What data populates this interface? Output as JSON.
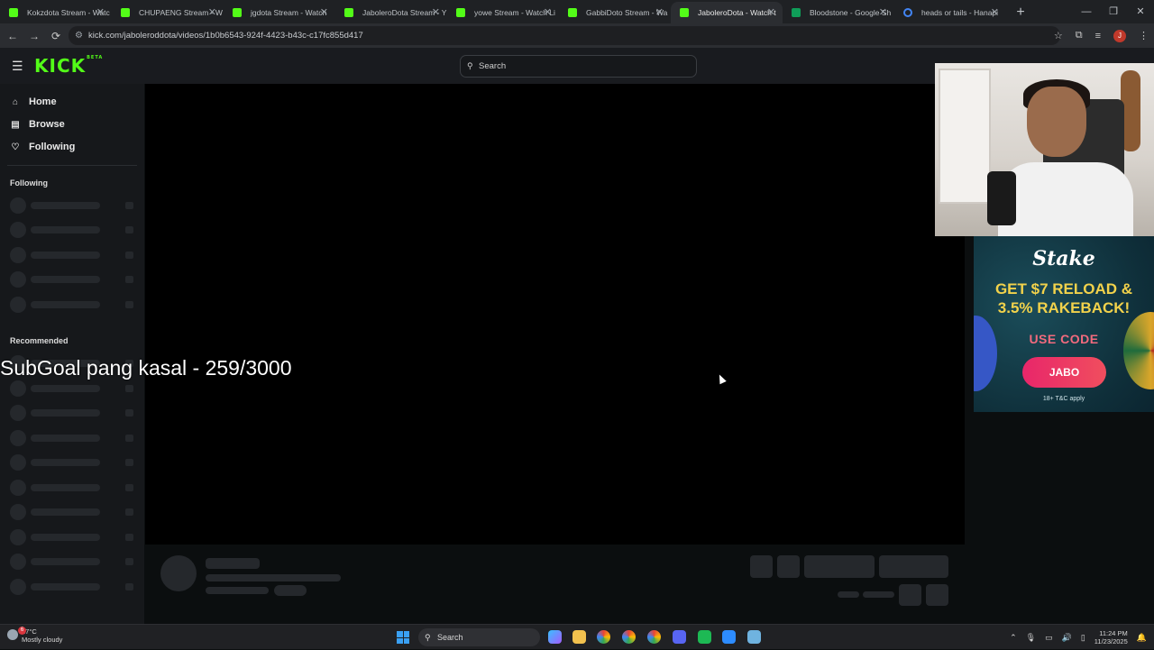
{
  "browser": {
    "tabs": [
      {
        "title": "Kokzdota Stream - Watc",
        "favicon": "kick-icon",
        "active": false
      },
      {
        "title": "CHUPAENG Stream - W",
        "favicon": "kick-icon",
        "active": false
      },
      {
        "title": "jgdota Stream - Watch",
        "favicon": "kick-icon",
        "active": false
      },
      {
        "title": "JaboleroDota Stream - Y",
        "favicon": "kick-icon",
        "active": false
      },
      {
        "title": "yowe Stream - Watch Li",
        "favicon": "kick-icon",
        "active": false
      },
      {
        "title": "GabbiDoto Stream - Wa",
        "favicon": "kick-icon",
        "active": false
      },
      {
        "title": "JaboleroDota - Watch t",
        "favicon": "kick-icon",
        "active": true
      },
      {
        "title": "Bloodstone - Google Sh",
        "favicon": "sheets-icon",
        "active": false
      },
      {
        "title": "heads or tails - Hanapi",
        "favicon": "google-icon",
        "active": false
      }
    ],
    "url": "kick.com/jaboleroddota/videos/1b0b6543-924f-4423-b43c-c17fc855d417",
    "profile_initial": "J"
  },
  "kick": {
    "logo": "KICK",
    "logo_badge": "BETA",
    "search_placeholder": "Search",
    "nav": {
      "home": "Home",
      "browse": "Browse",
      "following": "Following"
    },
    "sections": {
      "following": "Following",
      "recommended": "Recommended"
    }
  },
  "overlay": {
    "subgoal": "SubGoal pang kasal - 259/3000"
  },
  "ad": {
    "brand": "Stake",
    "headline_line1": "GET $7 RELOAD &",
    "headline_line2": "3.5% RAKEBACK!",
    "use_code": "USE CODE",
    "code": "JABO",
    "terms": "18+  T&C apply"
  },
  "taskbar": {
    "weather_temp": "27°C",
    "weather_desc": "Mostly cloudy",
    "weather_badge": "6",
    "search_label": "Search",
    "time": "11:24 PM",
    "date": "11/23/2025"
  }
}
